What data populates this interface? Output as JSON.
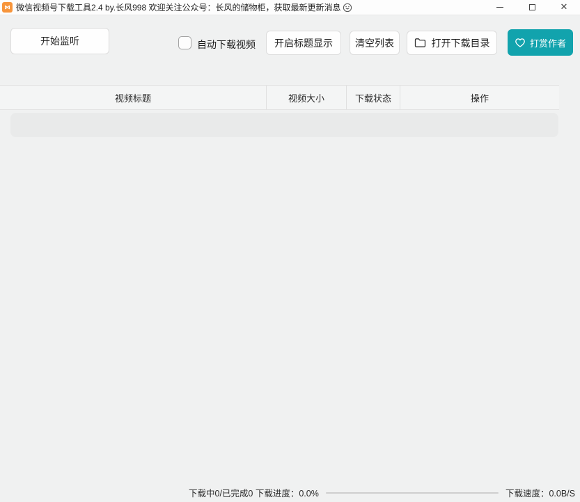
{
  "titlebar": {
    "title": "微信视频号下载工具2.4 by.长风998  欢迎关注公众号：长风的储物柜，获取最新更新消息",
    "icon": "wechat-channels-logo",
    "icon_color": "#f7953b",
    "controls": {
      "minimize": "minimize",
      "maximize": "maximize",
      "close": "close"
    }
  },
  "toolbar": {
    "start_listen_label": "开始监听",
    "auto_download_label": "自动下载视频",
    "auto_download_checked": false,
    "show_title_label": "开启标题显示",
    "clear_list_label": "清空列表",
    "open_dir_label": "打开下载目录",
    "open_dir_icon": "folder-icon",
    "donate_label": "打赏作者",
    "donate_icon": "heart-icon",
    "accent_color": "#12a3ad"
  },
  "table": {
    "columns": [
      "视频标题",
      "视频大小",
      "下载状态",
      "操作"
    ],
    "rows": []
  },
  "statusbar": {
    "left_text": "下载中0/已完成0 下载进度：0.0%",
    "right_text": "下载速度：0.0B/S",
    "downloading_count": 0,
    "completed_count": 0,
    "progress_percent": "0.0%",
    "speed": "0.0B/S"
  }
}
